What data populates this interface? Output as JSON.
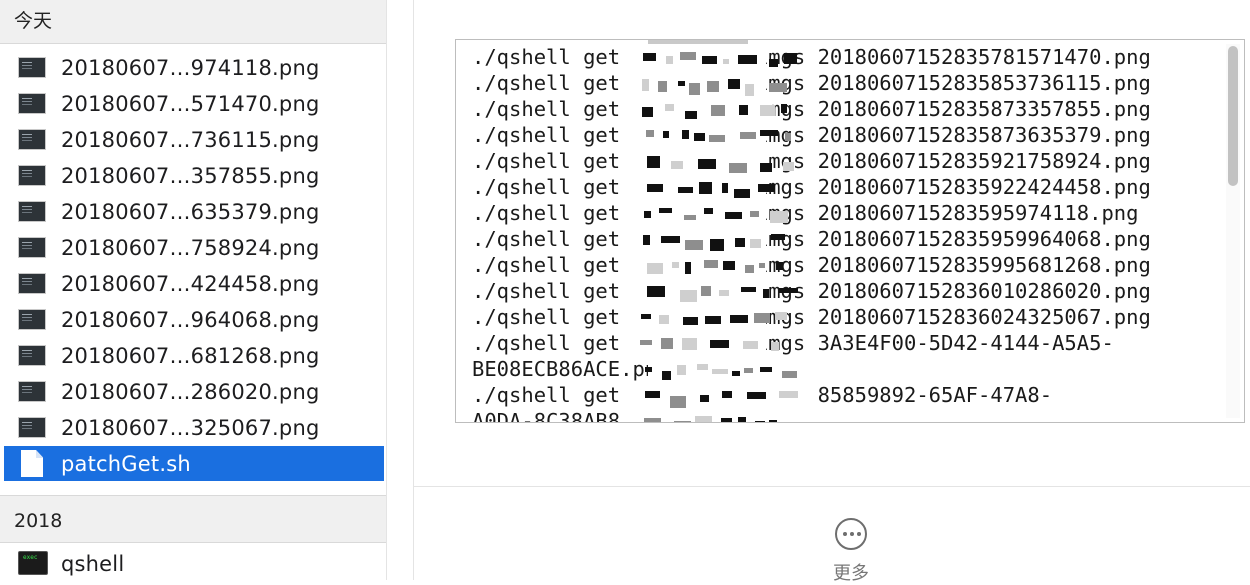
{
  "sidebar": {
    "today_header": "今天",
    "files": [
      {
        "name": "20180607…974118.png"
      },
      {
        "name": "20180607…571470.png"
      },
      {
        "name": "20180607…736115.png"
      },
      {
        "name": "20180607…357855.png"
      },
      {
        "name": "20180607…635379.png"
      },
      {
        "name": "20180607…758924.png"
      },
      {
        "name": "20180607…424458.png"
      },
      {
        "name": "20180607…964068.png"
      },
      {
        "name": "20180607…681268.png"
      },
      {
        "name": "20180607…286020.png"
      },
      {
        "name": "20180607…325067.png"
      }
    ],
    "selected_file": "patchGet.sh",
    "year_header": "2018",
    "year_files": [
      {
        "name": "qshell"
      }
    ]
  },
  "preview": {
    "lines": [
      "./qshell get           imgs 20180607152835781571470.png",
      "./qshell get           imgs 20180607152835853736115.png",
      "./qshell get           imgs 20180607152835873357855.png",
      "./qshell get           imgs 20180607152835873635379.png",
      "./qshell get           imgs 20180607152835921758924.png",
      "./qshell get           imgs 20180607152835922424458.png",
      "./qshell get           imgs 2018060715283595974118.png",
      "./qshell get           imgs 20180607152835959964068.png",
      "./qshell get           imgs 20180607152835995681268.png",
      "./qshell get           imgs 20180607152836010286020.png",
      "./qshell get           imgs 20180607152836024325067.png",
      "./qshell get           imgs 3A3E4F00-5D42-4144-A5A5-",
      "BE08ECB86ACE.png",
      "./qshell get                85859892-65AF-47A8-",
      "A0DA-8C38AB8"
    ],
    "more_label": "更多"
  }
}
